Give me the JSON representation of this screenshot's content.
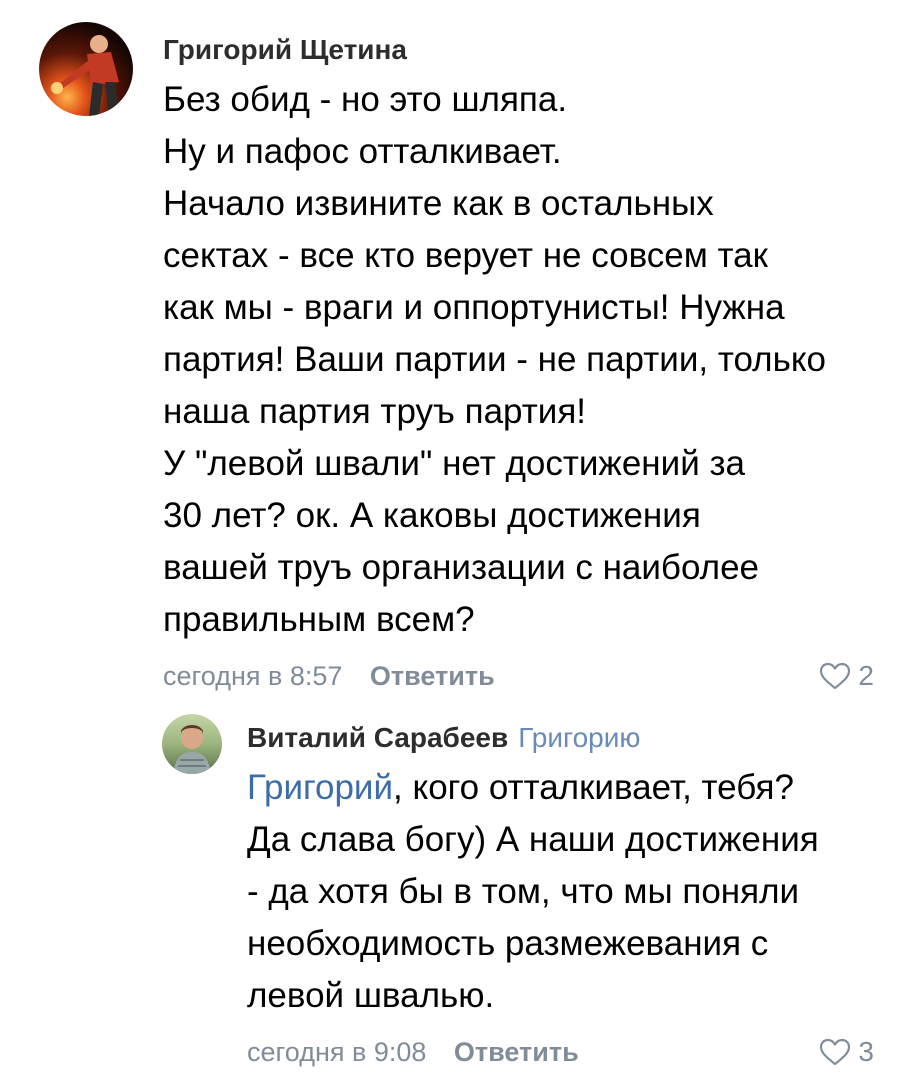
{
  "comments": [
    {
      "author": "Григорий Щетина",
      "reply_to": "",
      "mention": "",
      "lines": [
        "Без обид - но это шляпа.",
        "Ну и пафос отталкивает.",
        "Начало извините как в остальных",
        "сектах - все кто верует не совсем так",
        "как мы - враги и оппортунисты! Нужна",
        "партия! Ваши партии - не партии, только",
        "наша партия труъ партия!",
        "У \"левой швали\" нет достижений за",
        "30 лет? ок. А каковы достижения",
        "вашей труъ организации с наиболее",
        "правильным всем?"
      ],
      "date": "сегодня в 8:57",
      "reply_label": "Ответить",
      "likes": "2",
      "avatar_icon": "user-avatar"
    },
    {
      "author": "Виталий Сарабеев",
      "reply_to": "Григорию",
      "mention": "Григорий",
      "first_line_rest": ", кого отталкивает, тебя?",
      "lines": [
        "Да слава богу) А наши достижения",
        "- да хотя бы в том, что мы поняли",
        "необходимость размежевания с",
        "левой швалью."
      ],
      "date": "сегодня в 9:08",
      "reply_label": "Ответить",
      "likes": "3",
      "avatar_icon": "user-avatar"
    }
  ],
  "colors": {
    "text": "#000000",
    "author": "#2c2d2e",
    "meta": "#818c99",
    "link": "#3d6da8",
    "reply_to": "#6a8bb5"
  },
  "icons": {
    "like": "heart-outline-icon"
  }
}
